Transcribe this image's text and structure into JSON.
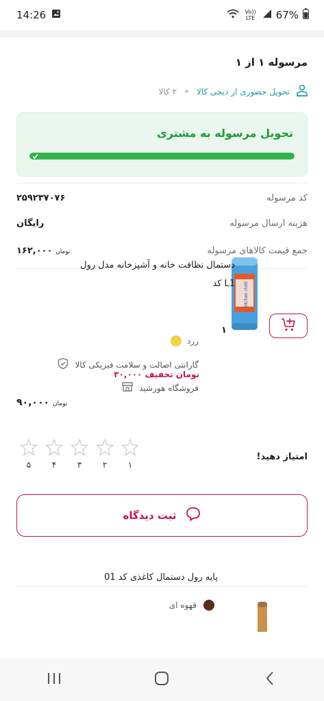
{
  "status_bar": {
    "time": "14:26",
    "network_label": "Vo)) LTE",
    "battery": "67%",
    "icons": [
      "image-icon",
      "wifi-icon",
      "signal-icon",
      "battery-icon"
    ]
  },
  "shipment": {
    "title": "مرسوله ۱ از ۱",
    "delivery_type": "تحویل حضوری از دیجی کالا",
    "item_count": "۲ کالا",
    "status_label": "تحویل مرسوله به مشتری",
    "progress": 1.0
  },
  "info": {
    "code_label": "کد مرسوله",
    "code_value": "۲۵۹۲۳۷۰۷۶",
    "shipping_label": "هزینه ارسال مرسوله",
    "shipping_value": "رایگان",
    "total_label": "جمع قیمت کالاهای مرسوله",
    "total_value": "۱۶۲,۰۰۰",
    "currency": "تومان"
  },
  "product1": {
    "title": "دستمال نظافت خانه و آشپزخانه مدل رول کد L1",
    "color": "زرد",
    "color_hex": "#f4d03f",
    "warranty": "گارانتی اصالت و سلامت فیزیکی کالا",
    "seller": "فروشگاه هورشید",
    "discount": "۳۰,۰۰۰ تومان تخفیف",
    "quantity": "۱",
    "price": "۹۰,۰۰۰",
    "currency": "تومان"
  },
  "rating": {
    "label": "امتیاز دهید!",
    "stars": [
      "۱",
      "۲",
      "۳",
      "۴",
      "۵"
    ]
  },
  "review_button": {
    "label": "ثبت دیدگاه"
  },
  "product2": {
    "title": "پایه رول دستمال کاغذی کد 01",
    "color": "قهوه ای",
    "color_hex": "#5a2a1c"
  },
  "colors": {
    "accent": "#c3154c",
    "teal": "#1a9aa0",
    "success": "#2fb24a"
  }
}
